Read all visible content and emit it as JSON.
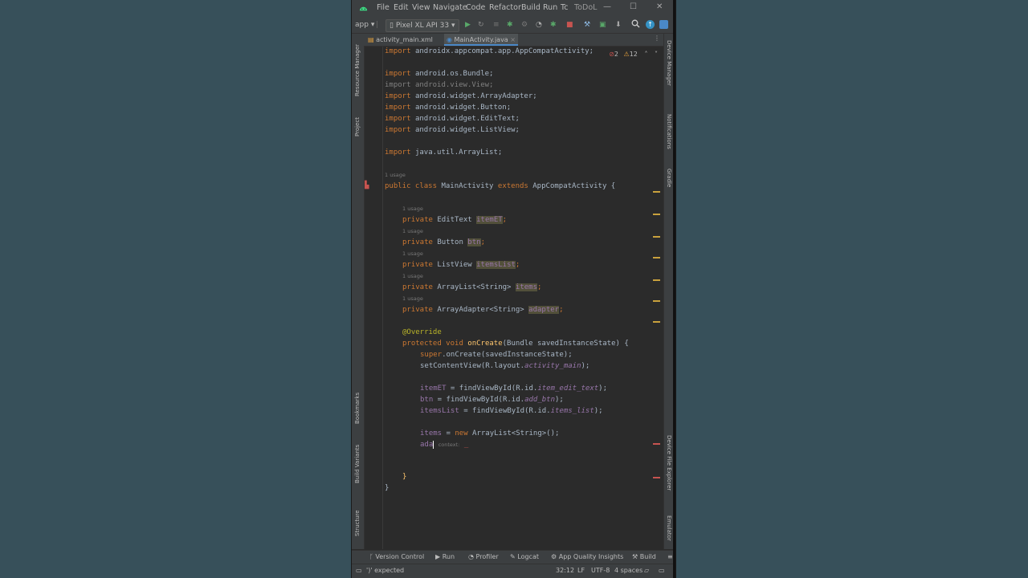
{
  "window": {
    "menus": [
      "File",
      "Edit",
      "View",
      "Navigate",
      "Code",
      "Refactor",
      "Build",
      "Run",
      "Tc"
    ],
    "project_title": "ToDoL",
    "controls": [
      "—",
      "☐",
      "✕"
    ]
  },
  "toolbar": {
    "module": "app",
    "device": "Pixel XL API 33"
  },
  "tabs": [
    {
      "label": "activity_main.xml",
      "active": false
    },
    {
      "label": "MainActivity.java",
      "active": true
    }
  ],
  "editor": {
    "inspection_errors": "2",
    "inspection_warnings": "12",
    "code": {
      "l1": [
        "import ",
        "androidx.appcompat.app.AppCompatActivity;"
      ],
      "l2": [
        "import ",
        "android.os.Bundle;"
      ],
      "l3": [
        "import ",
        "android.view.View;"
      ],
      "l4": [
        "import ",
        "android.widget.ArrayAdapter;"
      ],
      "l5": [
        "import ",
        "android.widget.Button;"
      ],
      "l6": [
        "import ",
        "android.widget.EditText;"
      ],
      "l7": [
        "import ",
        "android.widget.ListView;"
      ],
      "l8": [
        "import ",
        "java.util.ArrayList;"
      ],
      "usage": "1 usage",
      "l9": [
        "public class ",
        "MainActivity ",
        "extends ",
        "AppCompatActivity {"
      ],
      "f1": [
        "private ",
        "EditText ",
        "itemET",
        ";"
      ],
      "f2": [
        "private ",
        "Button ",
        "btn",
        ";"
      ],
      "f3": [
        "private ",
        "ListView ",
        "itemsList",
        ";"
      ],
      "f4": [
        "private ",
        "ArrayList<String> ",
        "items",
        ";"
      ],
      "f5": [
        "private ",
        "ArrayAdapter<String> ",
        "adapter",
        ";"
      ],
      "override": "@Override",
      "m1": [
        "protected void ",
        "onCreate",
        "(Bundle savedInstanceState) {"
      ],
      "m2": [
        "super",
        ".onCreate(savedInstanceState);"
      ],
      "m3": [
        "setContentView(R.layout.",
        "activity_main",
        ");"
      ],
      "m4": [
        "itemET",
        " = findViewById(R.id.",
        "item_edit_text",
        ");"
      ],
      "m5": [
        "btn",
        " = findViewById(R.id.",
        "add_btn",
        ");"
      ],
      "m6": [
        "itemsList",
        " = findViewById(R.id.",
        "items_list",
        ");"
      ],
      "m7": [
        "items",
        " = ",
        "new ",
        "ArrayList<String>();"
      ],
      "m8": [
        "ada",
        "context:"
      ],
      "close_method": "}",
      "close_class": "}"
    }
  },
  "left_strip": [
    "Resource Manager",
    "Project",
    "Bookmarks",
    "Build Variants",
    "Structure"
  ],
  "right_strip": [
    "Device Manager",
    "Notifications",
    "Gradle",
    "Device File Explorer",
    "Emulator"
  ],
  "bottom_tabs": [
    "Version Control",
    "Run",
    "Profiler",
    "Logcat",
    "App Quality Insights",
    "Build"
  ],
  "status": {
    "message": "')' expected",
    "position": "32:12",
    "line_sep": "LF",
    "encoding": "UTF-8",
    "indent": "4 spaces"
  }
}
